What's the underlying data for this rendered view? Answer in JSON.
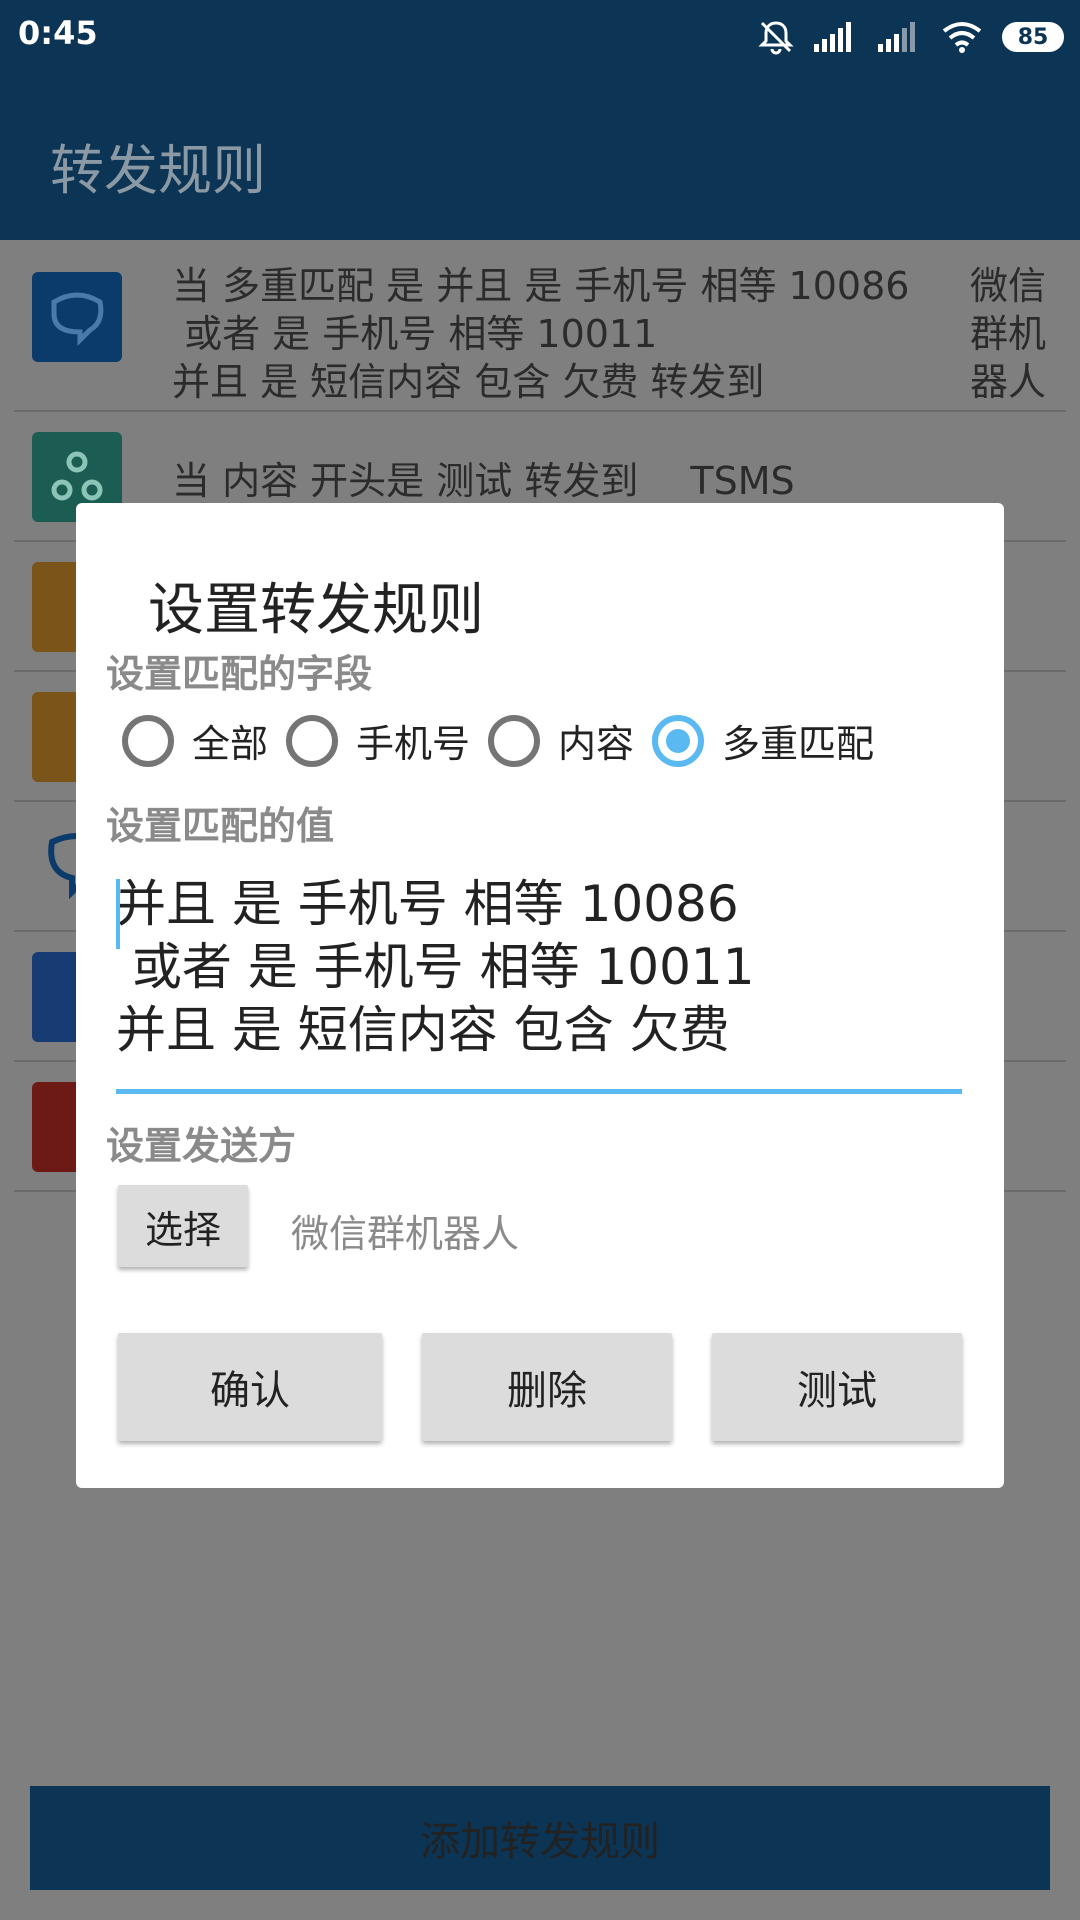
{
  "status_bar": {
    "time": "0:45",
    "battery": "85"
  },
  "app_bar": {
    "title": "转发规则"
  },
  "rules": [
    {
      "icon": "wechat-bot-icon",
      "line1": "当 多重匹配 是 并且 是 手机号 相等 10086",
      "line2": " 或者 是 手机号 相等 10011",
      "line3": "并且 是 短信内容 包含 欠费 转发到",
      "sender": "微信群机器人"
    },
    {
      "icon": "webhook-icon",
      "text": "当 内容 开头是 测试 转发到",
      "sender": "TSMS"
    }
  ],
  "add_button": "添加转发规则",
  "dialog": {
    "title": "设置转发规则",
    "field_label": "设置匹配的字段",
    "options": [
      "全部",
      "手机号",
      "内容",
      "多重匹配"
    ],
    "selected_option": "多重匹配",
    "value_label": "设置匹配的值",
    "value_lines": [
      "并且 是 手机号 相等 10086",
      " 或者 是 手机号 相等 10011",
      "并且 是 短信内容 包含 欠费"
    ],
    "sender_label": "设置发送方",
    "select_button": "选择",
    "sender_value": "微信群机器人",
    "confirm_button": "确认",
    "delete_button": "删除",
    "test_button": "测试"
  },
  "colors": {
    "primary": "#0b3455",
    "accent": "#5ab9f1"
  }
}
